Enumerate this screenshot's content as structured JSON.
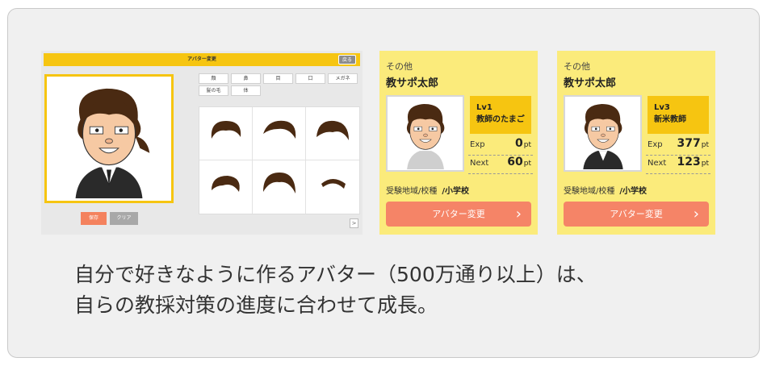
{
  "editor": {
    "title": "アバター変更",
    "back_label": "戻る",
    "tabs": [
      "顔",
      "鼻",
      "目",
      "口",
      "メガネ",
      "髪の毛",
      "体"
    ],
    "save_label": "保存",
    "clear_label": "クリア",
    "scroll_label": ">"
  },
  "profiles": [
    {
      "category": "その他",
      "name": "教サポ太郎",
      "level": "Lv1",
      "title": "教師のたまご",
      "exp_label": "Exp",
      "exp_value": "0",
      "next_label": "Next",
      "next_value": "60",
      "unit": "pt",
      "region_label": "受験地域/校種",
      "region_value": "/小学校",
      "button_label": "アバター変更"
    },
    {
      "category": "その他",
      "name": "教サポ太郎",
      "level": "Lv3",
      "title": "新米教師",
      "exp_label": "Exp",
      "exp_value": "377",
      "next_label": "Next",
      "next_value": "123",
      "unit": "pt",
      "region_label": "受験地域/校種",
      "region_value": "/小学校",
      "button_label": "アバター変更"
    }
  ],
  "caption": {
    "line1": "自分で好きなように作るアバター（500万通り以上）は、",
    "line2": "自らの教採対策の進度に合わせて成長。"
  },
  "colors": {
    "accent_yellow": "#f6c511",
    "card_yellow": "#fbeb7b",
    "button_orange": "#f58467",
    "hair_brown": "#4a2a12"
  }
}
